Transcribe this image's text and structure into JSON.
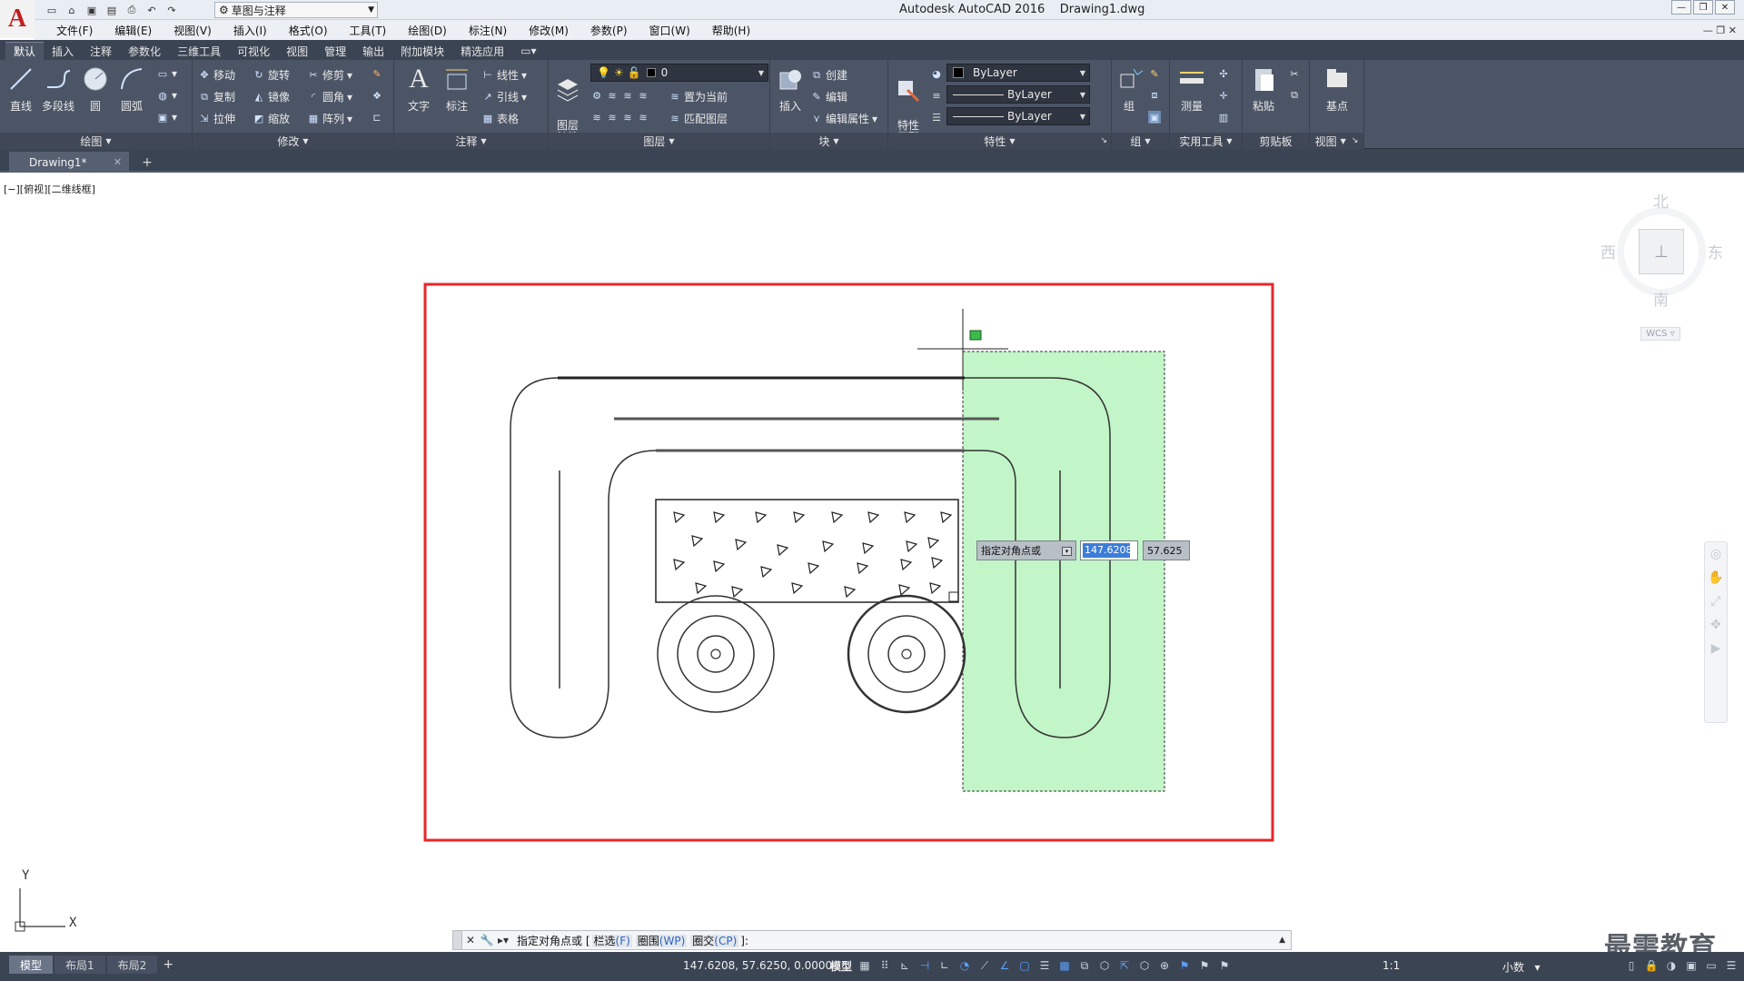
{
  "app": {
    "logo_letter": "A",
    "window_title": "Autodesk AutoCAD 2016    Drawing1.dwg",
    "workspace": "草图与注释"
  },
  "menu": [
    "文件(F)",
    "编辑(E)",
    "视图(V)",
    "插入(I)",
    "格式(O)",
    "工具(T)",
    "绘图(D)",
    "标注(N)",
    "修改(M)",
    "参数(P)",
    "窗口(W)",
    "帮助(H)"
  ],
  "ribbon_tabs": [
    "默认",
    "插入",
    "注释",
    "参数化",
    "三维工具",
    "可视化",
    "视图",
    "管理",
    "输出",
    "附加模块",
    "精选应用"
  ],
  "ribbon": {
    "draw": {
      "title": "绘图",
      "line": "直线",
      "polyline": "多段线",
      "circle": "圆",
      "arc": "圆弧"
    },
    "modify": {
      "title": "修改",
      "move": "移动",
      "rotate": "旋转",
      "trim": "修剪",
      "copy": "复制",
      "mirror": "镜像",
      "fillet": "圆角",
      "stretch": "拉伸",
      "scale": "缩放",
      "array": "阵列"
    },
    "annotation": {
      "title": "注释",
      "text": "文字",
      "dimension": "标注",
      "linear": "线性",
      "leader": "引线",
      "table": "表格"
    },
    "layers": {
      "title": "图层",
      "layer_props": "图层\n特性",
      "current_layer": "0",
      "make_current": "置为当前",
      "match_layer": "匹配图层"
    },
    "block": {
      "title": "块",
      "insert": "插入",
      "create": "创建",
      "edit": "编辑",
      "edit_attr": "编辑属性"
    },
    "properties": {
      "title": "特性",
      "match": "特性\n匹配",
      "color": "ByLayer",
      "linetype": "ByLayer",
      "lineweight": "ByLayer"
    },
    "groups": {
      "title": "组",
      "group": "组"
    },
    "utilities": {
      "title": "实用工具",
      "measure": "测量"
    },
    "clipboard": {
      "title": "剪贴板",
      "paste": "粘贴"
    },
    "view": {
      "title": "视图",
      "base": "基点"
    }
  },
  "file_tab": {
    "name": "Drawing1*",
    "add": "+"
  },
  "viewport_label": "[−][俯视][二维线框]",
  "viewcube": {
    "north": "北",
    "south": "南",
    "east": "东",
    "west": "西",
    "wcs": "WCS"
  },
  "dynamic_input": {
    "prompt": "指定对角点或",
    "x_value": "147.6208",
    "y_value": "57.625"
  },
  "ucs": {
    "x": "X",
    "y": "Y"
  },
  "command_line": {
    "prompt": "指定对角点或 [",
    "opt1_label": "栏选",
    "opt1_key": "(F)",
    "opt2_label": "圈围",
    "opt2_key": "(WP)",
    "opt3_label": "圈交",
    "opt3_key": "(CP)",
    "suffix": "]:"
  },
  "watermark": "最需教育",
  "status": {
    "layout_tabs": [
      "模型",
      "布局1",
      "布局2"
    ],
    "coords": "147.6208, 57.6250, 0.0000",
    "model": "模型",
    "scale": "1:1",
    "units": "小数"
  }
}
